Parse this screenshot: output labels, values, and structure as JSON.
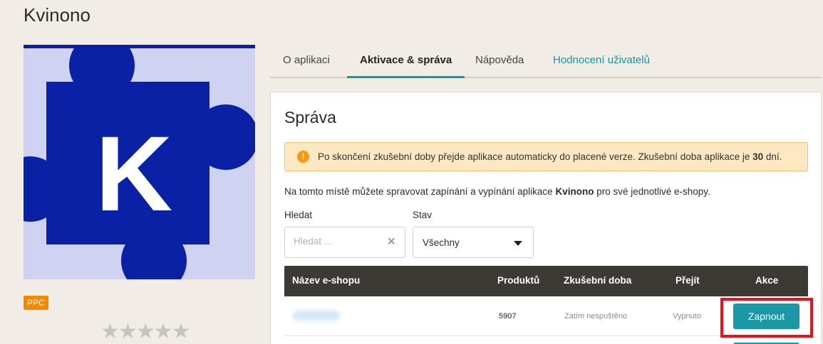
{
  "app": {
    "title": "Kvinono",
    "logo_letter": "K",
    "badge": "PPC",
    "rating_stars": "★★★★★"
  },
  "tabs": [
    {
      "label": "O aplikaci"
    },
    {
      "label": "Aktivace & správa"
    },
    {
      "label": "Nápověda"
    },
    {
      "label": "Hodnocení uživatelů"
    }
  ],
  "panel": {
    "title": "Správa",
    "alert": {
      "icon": "!",
      "text_before": "Po skončení zkušební doby přejde aplikace automaticky do placené verze. Zkušební doba aplikace je ",
      "days": "30",
      "text_after": " dní."
    },
    "description": {
      "before": "Na tomto místě můžete spravovat zapínání a vypínání aplikace ",
      "app_name": "Kvinono",
      "after": " pro své jednotlivé e-shopy."
    },
    "search": {
      "label": "Hledat",
      "placeholder": "Hledat ...",
      "value": "",
      "clear": "✕"
    },
    "status": {
      "label": "Stav",
      "value": "Všechny"
    },
    "table": {
      "headers": {
        "name": "Název e-shopu",
        "products": "Produktů",
        "trial": "Zkušební doba",
        "switch": "Přejít",
        "action": "Akce"
      },
      "rows": [
        {
          "products": "5907",
          "trial": "Zatím nespuštěno",
          "switch": "Vypnuto",
          "action": "Zapnout"
        }
      ]
    }
  },
  "colors": {
    "accent": "#1397a6",
    "logo_blue": "#0a21a6",
    "logo_bg": "#cfd3f1",
    "badge": "#f08a00",
    "highlight": "#e8121b"
  }
}
